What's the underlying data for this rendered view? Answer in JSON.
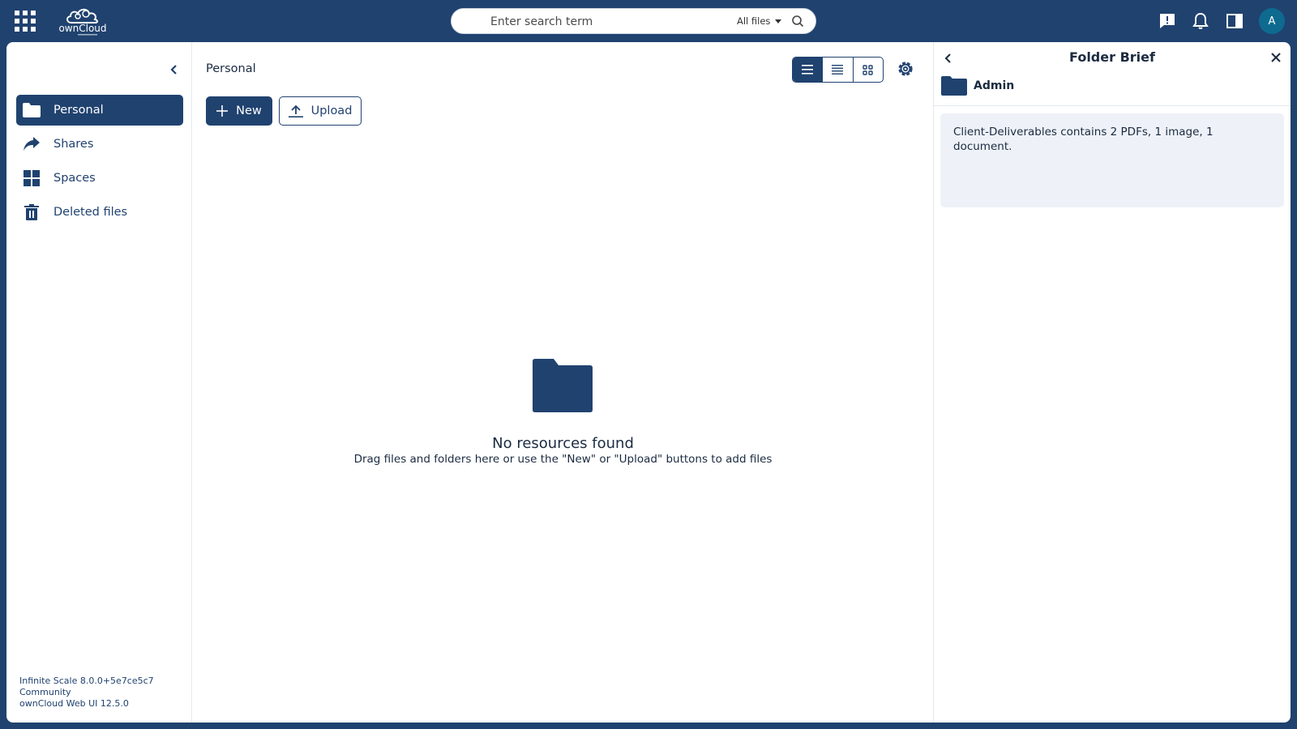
{
  "topbar": {
    "logo_text": "ownCloud",
    "search": {
      "placeholder": "Enter search term",
      "scope": "All files"
    },
    "avatar_initial": "A"
  },
  "sidebar": {
    "items": [
      {
        "label": "Personal",
        "icon": "folder-icon",
        "active": true
      },
      {
        "label": "Shares",
        "icon": "share-icon",
        "active": false
      },
      {
        "label": "Spaces",
        "icon": "spaces-grid-icon",
        "active": false
      },
      {
        "label": "Deleted files",
        "icon": "trash-icon",
        "active": false
      }
    ],
    "version": {
      "line1": "Infinite Scale 8.0.0+5e7ce5c7",
      "line2": "Community",
      "line3": "ownCloud Web UI 12.5.0"
    }
  },
  "main": {
    "breadcrumb": "Personal",
    "new_label": "New",
    "upload_label": "Upload",
    "empty_title": "No resources found",
    "empty_subtitle": "Drag files and folders here or use the \"New\" or \"Upload\" buttons to add files"
  },
  "panel": {
    "title": "Folder Brief",
    "folder_name": "Admin",
    "summary": "Client-Deliverables contains 2 PDFs, 1 image, 1 document."
  },
  "colors": {
    "brand": "#20426f",
    "panel_box": "#eef2f8",
    "avatar": "#0e6b8f"
  }
}
